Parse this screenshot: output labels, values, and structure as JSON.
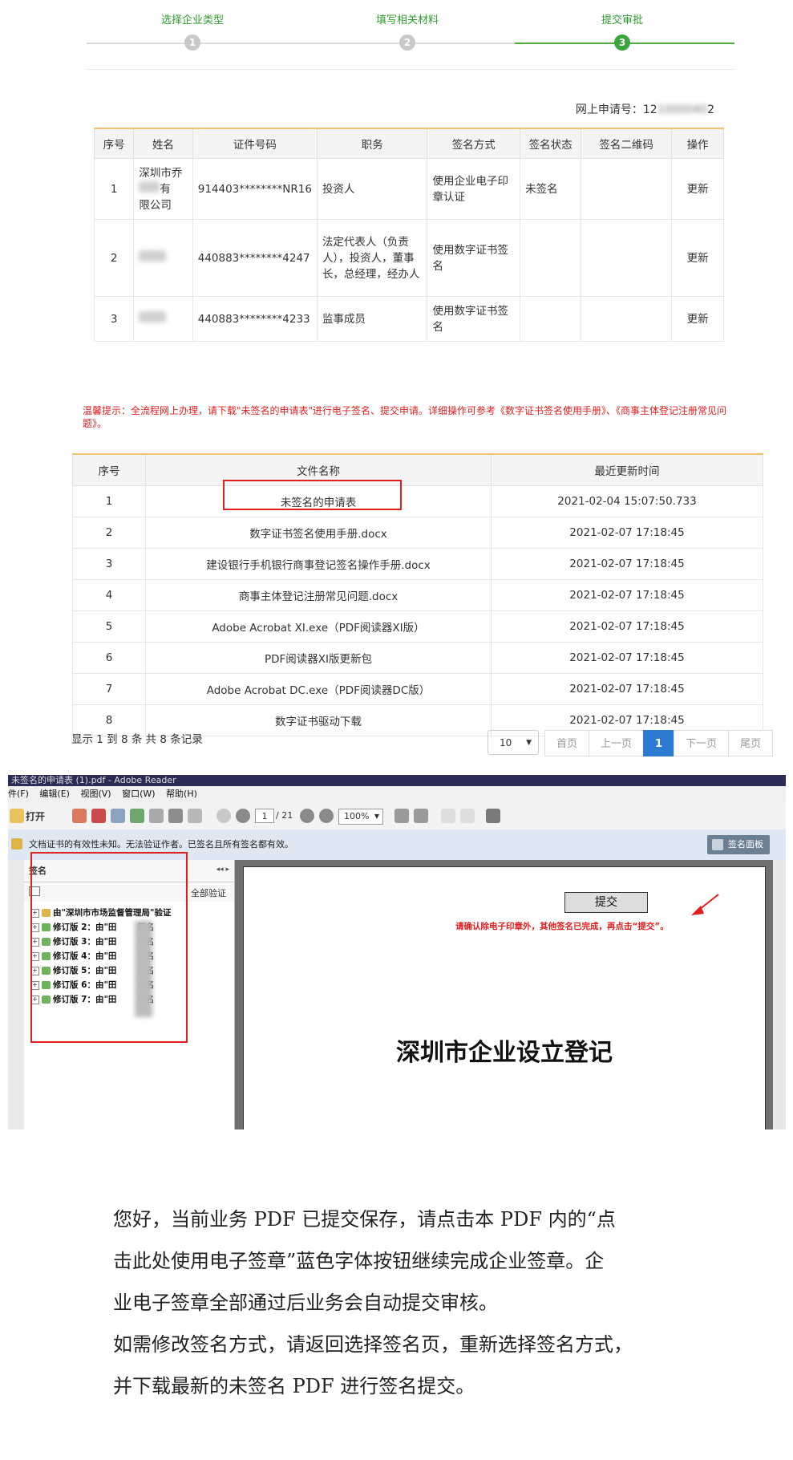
{
  "stepper": {
    "steps": [
      {
        "label": "选择企业类型",
        "num": "1"
      },
      {
        "label": "填写相关材料",
        "num": "2"
      },
      {
        "label": "提交审批",
        "num": "3"
      }
    ]
  },
  "application": {
    "label": "网上申请号：",
    "number_prefix": "12",
    "number_blurred": "1000040",
    "number_suffix": "2"
  },
  "signers": {
    "headers": [
      "序号",
      "姓名",
      "证件号码",
      "职务",
      "签名方式",
      "签名状态",
      "签名二维码",
      "操作"
    ],
    "rows": [
      {
        "no": "1",
        "name_a": "深圳市乔",
        "name_b": "有",
        "name_c": "限公司",
        "id": "914403********NR16",
        "role": "投资人",
        "method": "使用企业电子印章认证",
        "status": "未签名",
        "qr": "",
        "action": "更新"
      },
      {
        "no": "2",
        "name_a": "",
        "name_b": "",
        "name_c": "",
        "id": "440883********4247",
        "role": "法定代表人（负责人），投资人，董事长，总经理，经办人",
        "method": "使用数字证书签名",
        "status": "",
        "qr": "",
        "action": "更新"
      },
      {
        "no": "3",
        "name_a": "",
        "name_b": "",
        "name_c": "",
        "id": "440883********4233",
        "role": "监事成员",
        "method": "使用数字证书签名",
        "status": "",
        "qr": "",
        "action": "更新"
      }
    ]
  },
  "tip": "温馨提示：全流程网上办理，请下载\"未签名的申请表\"进行电子签名、提交申请。详细操作可参考《数字证书签名使用手册》、《商事主体登记注册常见问题》。",
  "files": {
    "headers": [
      "序号",
      "文件名称",
      "最近更新时间"
    ],
    "rows": [
      {
        "no": "1",
        "name": "未签名的申请表",
        "time": "2021-02-04 15:07:50.733"
      },
      {
        "no": "2",
        "name": "数字证书签名使用手册.docx",
        "time": "2021-02-07 17:18:45"
      },
      {
        "no": "3",
        "name": "建设银行手机银行商事登记签名操作手册.docx",
        "time": "2021-02-07 17:18:45"
      },
      {
        "no": "4",
        "name": "商事主体登记注册常见问题.docx",
        "time": "2021-02-07 17:18:45"
      },
      {
        "no": "5",
        "name": "Adobe Acrobat XI.exe（PDF阅读器XI版）",
        "time": "2021-02-07 17:18:45"
      },
      {
        "no": "6",
        "name": "PDF阅读器XI版更新包",
        "time": "2021-02-07 17:18:45"
      },
      {
        "no": "7",
        "name": "Adobe Acrobat DC.exe（PDF阅读器DC版）",
        "time": "2021-02-07 17:18:45"
      },
      {
        "no": "8",
        "name": "数字证书驱动下载",
        "time": "2021-02-07 17:18:45"
      }
    ]
  },
  "pagination": {
    "summary": "显示 1 到 8 条 共 8 条记录",
    "page_size": "10",
    "first": "首页",
    "prev": "上一页",
    "current": "1",
    "next": "下一页",
    "last": "尾页"
  },
  "reader": {
    "title": "未签名的申请表 (1).pdf - Adobe Reader",
    "menu": [
      "件(F)",
      "编辑(E)",
      "视图(V)",
      "窗口(W)",
      "帮助(H)"
    ],
    "open_label": "打开",
    "page_current": "1",
    "page_total": "/ 21",
    "zoom": "100%",
    "info": "文档证书的有效性未知。无法验证作者。已签名且所有签名都有效。",
    "sig_panel_button": "签名面板",
    "panel_title": "签名",
    "verify_all": "全部验证",
    "tree": [
      "由\"深圳市市场监督管理局\"验证",
      "修订版 2：由\"田",
      "修订版 3：由\"田",
      "修订版 4：由\"田",
      "修订版 5：由\"田",
      "修订版 6：由\"田",
      "修订版 7：由\"田"
    ],
    "tree_suffix": "签名",
    "submit_button": "提交",
    "red_note": "请确认除电子印章外，其他签名已完成，再点击“提交”。",
    "doc_title": "深圳市企业设立登记"
  },
  "paragraph": [
    "您好，当前业务 PDF 已提交保存，请点击本 PDF 内的“点",
    "击此处使用电子签章”蓝色字体按钮继续完成企业签章。企",
    "业电子签章全部通过后业务会自动提交审核。",
    "如需修改签名方式，请返回选择签名页，重新选择签名方式，",
    "并下载最新的未签名 PDF 进行签名提交。"
  ],
  "colors": {
    "green": "#3aa53a",
    "link": "#2a77c9",
    "red": "#e01e1e",
    "pager_active": "#2c7bd1"
  }
}
